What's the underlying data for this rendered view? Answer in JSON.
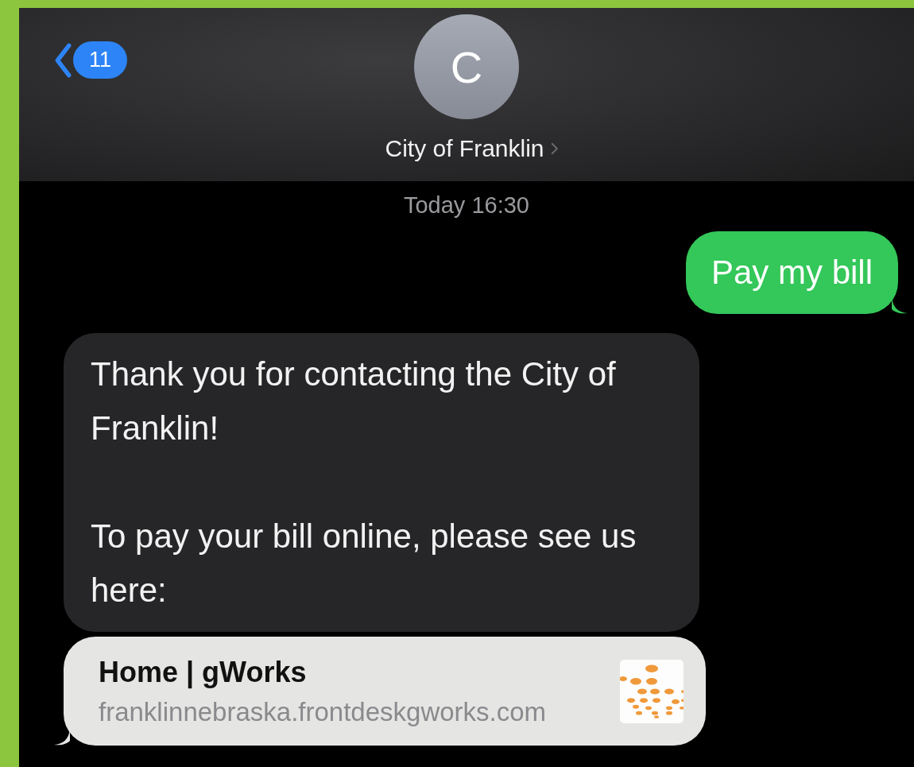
{
  "header": {
    "back_count": "11",
    "avatar_letter": "C",
    "contact_name": "City of Franklin"
  },
  "timestamp": "Today 16:30",
  "messages": [
    {
      "kind": "sent",
      "paragraphs": [
        "Pay my bill"
      ]
    },
    {
      "kind": "received",
      "paragraphs": [
        "Thank you for contacting the City of Franklin!",
        "To pay your bill online, please see us here:"
      ]
    },
    {
      "kind": "link",
      "title": "Home | gWorks",
      "url": "franklinnebraska.frontdeskgworks.com"
    }
  ]
}
